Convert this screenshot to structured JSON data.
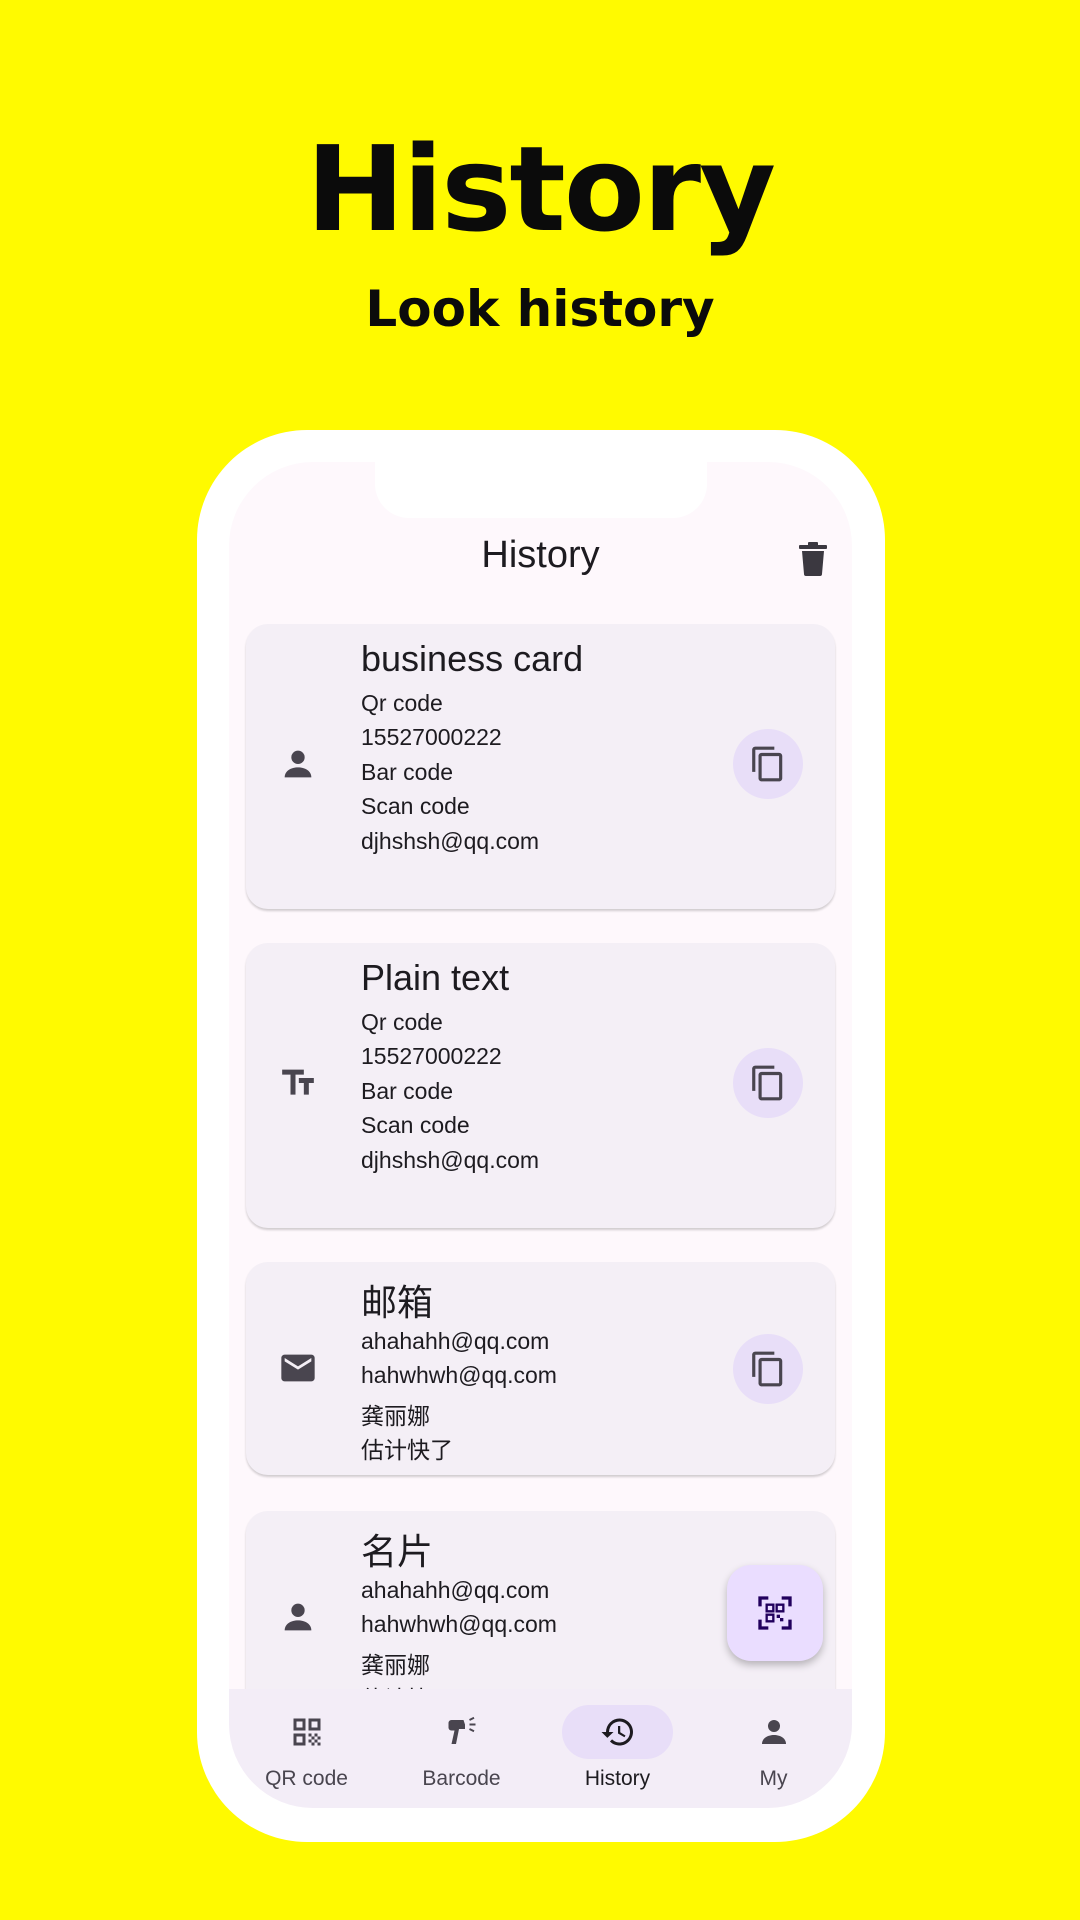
{
  "hero": {
    "title": "History",
    "subtitle": "Look history"
  },
  "appbar": {
    "title": "History",
    "action_icon": "delete-icon"
  },
  "cards": [
    {
      "icon": "person-icon",
      "title": " business card",
      "lines": [
        "Qr code",
        "15527000222",
        "Bar code",
        "Scan code",
        "djhshsh@qq.com"
      ]
    },
    {
      "icon": "text-fields-icon",
      "title": "Plain text",
      "lines": [
        "Qr code",
        "15527000222",
        "Bar code",
        "Scan code",
        "djhshsh@qq.com"
      ]
    },
    {
      "icon": "mail-icon",
      "title": "邮箱",
      "lines": [
        "ahahahh@qq.com",
        "hahwhwh@qq.com",
        "龚丽娜",
        "估计快了"
      ]
    },
    {
      "icon": "person-icon",
      "title": "名片",
      "lines": [
        "ahahahh@qq.com",
        "hahwhwh@qq.com",
        "龚丽娜",
        "估计快了"
      ]
    }
  ],
  "fab": {
    "icon": "qr-scan-icon"
  },
  "nav": [
    {
      "label": "QR code",
      "icon": "qr-code-icon",
      "active": false
    },
    {
      "label": "Barcode",
      "icon": "barcode-scanner-icon",
      "active": false
    },
    {
      "label": "History",
      "icon": "history-icon",
      "active": true
    },
    {
      "label": "My",
      "icon": "person-icon",
      "active": false
    }
  ],
  "colors": {
    "background": "#FFFA00",
    "card": "#F4EFF6",
    "accent": "#E8DEF8",
    "icon": "#49454F"
  }
}
